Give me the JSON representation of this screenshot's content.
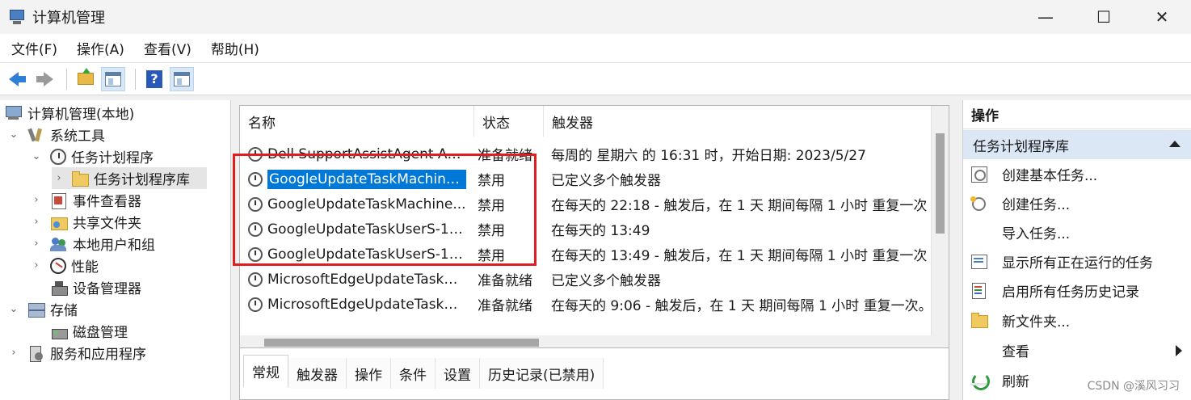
{
  "window": {
    "title": "计算机管理",
    "minimize": "—",
    "maximize": "☐",
    "close": "✕"
  },
  "menu": [
    "文件(F)",
    "操作(A)",
    "查看(V)",
    "帮助(H)"
  ],
  "toolbar": {
    "help": "?"
  },
  "tree": [
    {
      "label": "计算机管理(本地)",
      "twisty": "",
      "icon": "computer-icon",
      "level": 0
    },
    {
      "label": "系统工具",
      "twisty": "⌄",
      "icon": "tools-icon",
      "level": 1
    },
    {
      "label": "任务计划程序",
      "twisty": "⌄",
      "icon": "clock-icon",
      "level": 2
    },
    {
      "label": "任务计划程序库",
      "twisty": "›",
      "icon": "folder-clock-icon",
      "level": 3,
      "selected": true
    },
    {
      "label": "事件查看器",
      "twisty": "›",
      "icon": "event-viewer-icon",
      "level": 2
    },
    {
      "label": "共享文件夹",
      "twisty": "›",
      "icon": "shared-folder-icon",
      "level": 2
    },
    {
      "label": "本地用户和组",
      "twisty": "›",
      "icon": "users-icon",
      "level": 2
    },
    {
      "label": "性能",
      "twisty": "›",
      "icon": "performance-icon",
      "level": 2
    },
    {
      "label": "设备管理器",
      "twisty": "",
      "icon": "device-manager-icon",
      "level": 2
    },
    {
      "label": "存储",
      "twisty": "⌄",
      "icon": "storage-icon",
      "level": 1
    },
    {
      "label": "磁盘管理",
      "twisty": "",
      "icon": "disk-icon",
      "level": 2
    },
    {
      "label": "服务和应用程序",
      "twisty": "›",
      "icon": "services-icon",
      "level": 1
    }
  ],
  "task_list": {
    "columns": [
      "名称",
      "状态",
      "触发器"
    ],
    "rows": [
      {
        "name": "Dell SupportAssistAgent Aut...",
        "status": "准备就绪",
        "trigger": "每周的 星期六 的 16:31 时，开始日期: 2023/5/27"
      },
      {
        "name": "GoogleUpdateTaskMachine...",
        "status": "禁用",
        "trigger": "已定义多个触发器",
        "selected": true
      },
      {
        "name": "GoogleUpdateTaskMachine...",
        "status": "禁用",
        "trigger": "在每天的 22:18 - 触发后，在 1 天 期间每隔 1 小时 重复一次"
      },
      {
        "name": "GoogleUpdateTaskUserS-1-...",
        "status": "禁用",
        "trigger": "在每天的 13:49"
      },
      {
        "name": "GoogleUpdateTaskUserS-1-...",
        "status": "禁用",
        "trigger": "在每天的 13:49 - 触发后，在 1 天 期间每隔 1 小时 重复一次"
      },
      {
        "name": "MicrosoftEdgeUpdateTaskM...",
        "status": "准备就绪",
        "trigger": "已定义多个触发器"
      },
      {
        "name": "MicrosoftEdgeUpdateTaskM...",
        "status": "准备就绪",
        "trigger": "在每天的 9:06 - 触发后，在 1 天 期间每隔 1 小时 重复一次。"
      }
    ]
  },
  "detail_tabs": [
    "常规",
    "触发器",
    "操作",
    "条件",
    "设置",
    "历史记录(已禁用)"
  ],
  "actions": {
    "header": "操作",
    "section": "任务计划程序库",
    "items": [
      {
        "label": "创建基本任务...",
        "icon": "create-basic-task-icon"
      },
      {
        "label": "创建任务...",
        "icon": "create-task-icon"
      },
      {
        "label": "导入任务...",
        "icon": ""
      },
      {
        "label": "显示所有正在运行的任务",
        "icon": "running-tasks-icon"
      },
      {
        "label": "启用所有任务历史记录",
        "icon": "task-history-icon"
      },
      {
        "label": "新文件夹...",
        "icon": "new-folder-icon"
      },
      {
        "label": "查看",
        "icon": "",
        "submenu": true
      },
      {
        "label": "刷新",
        "icon": "refresh-icon"
      }
    ]
  },
  "watermark": "CSDN @溪风习习",
  "colors": {
    "selection": "#0078d7",
    "highlight_box": "#e01e1e",
    "action_section_bg": "#dbe7f5"
  }
}
